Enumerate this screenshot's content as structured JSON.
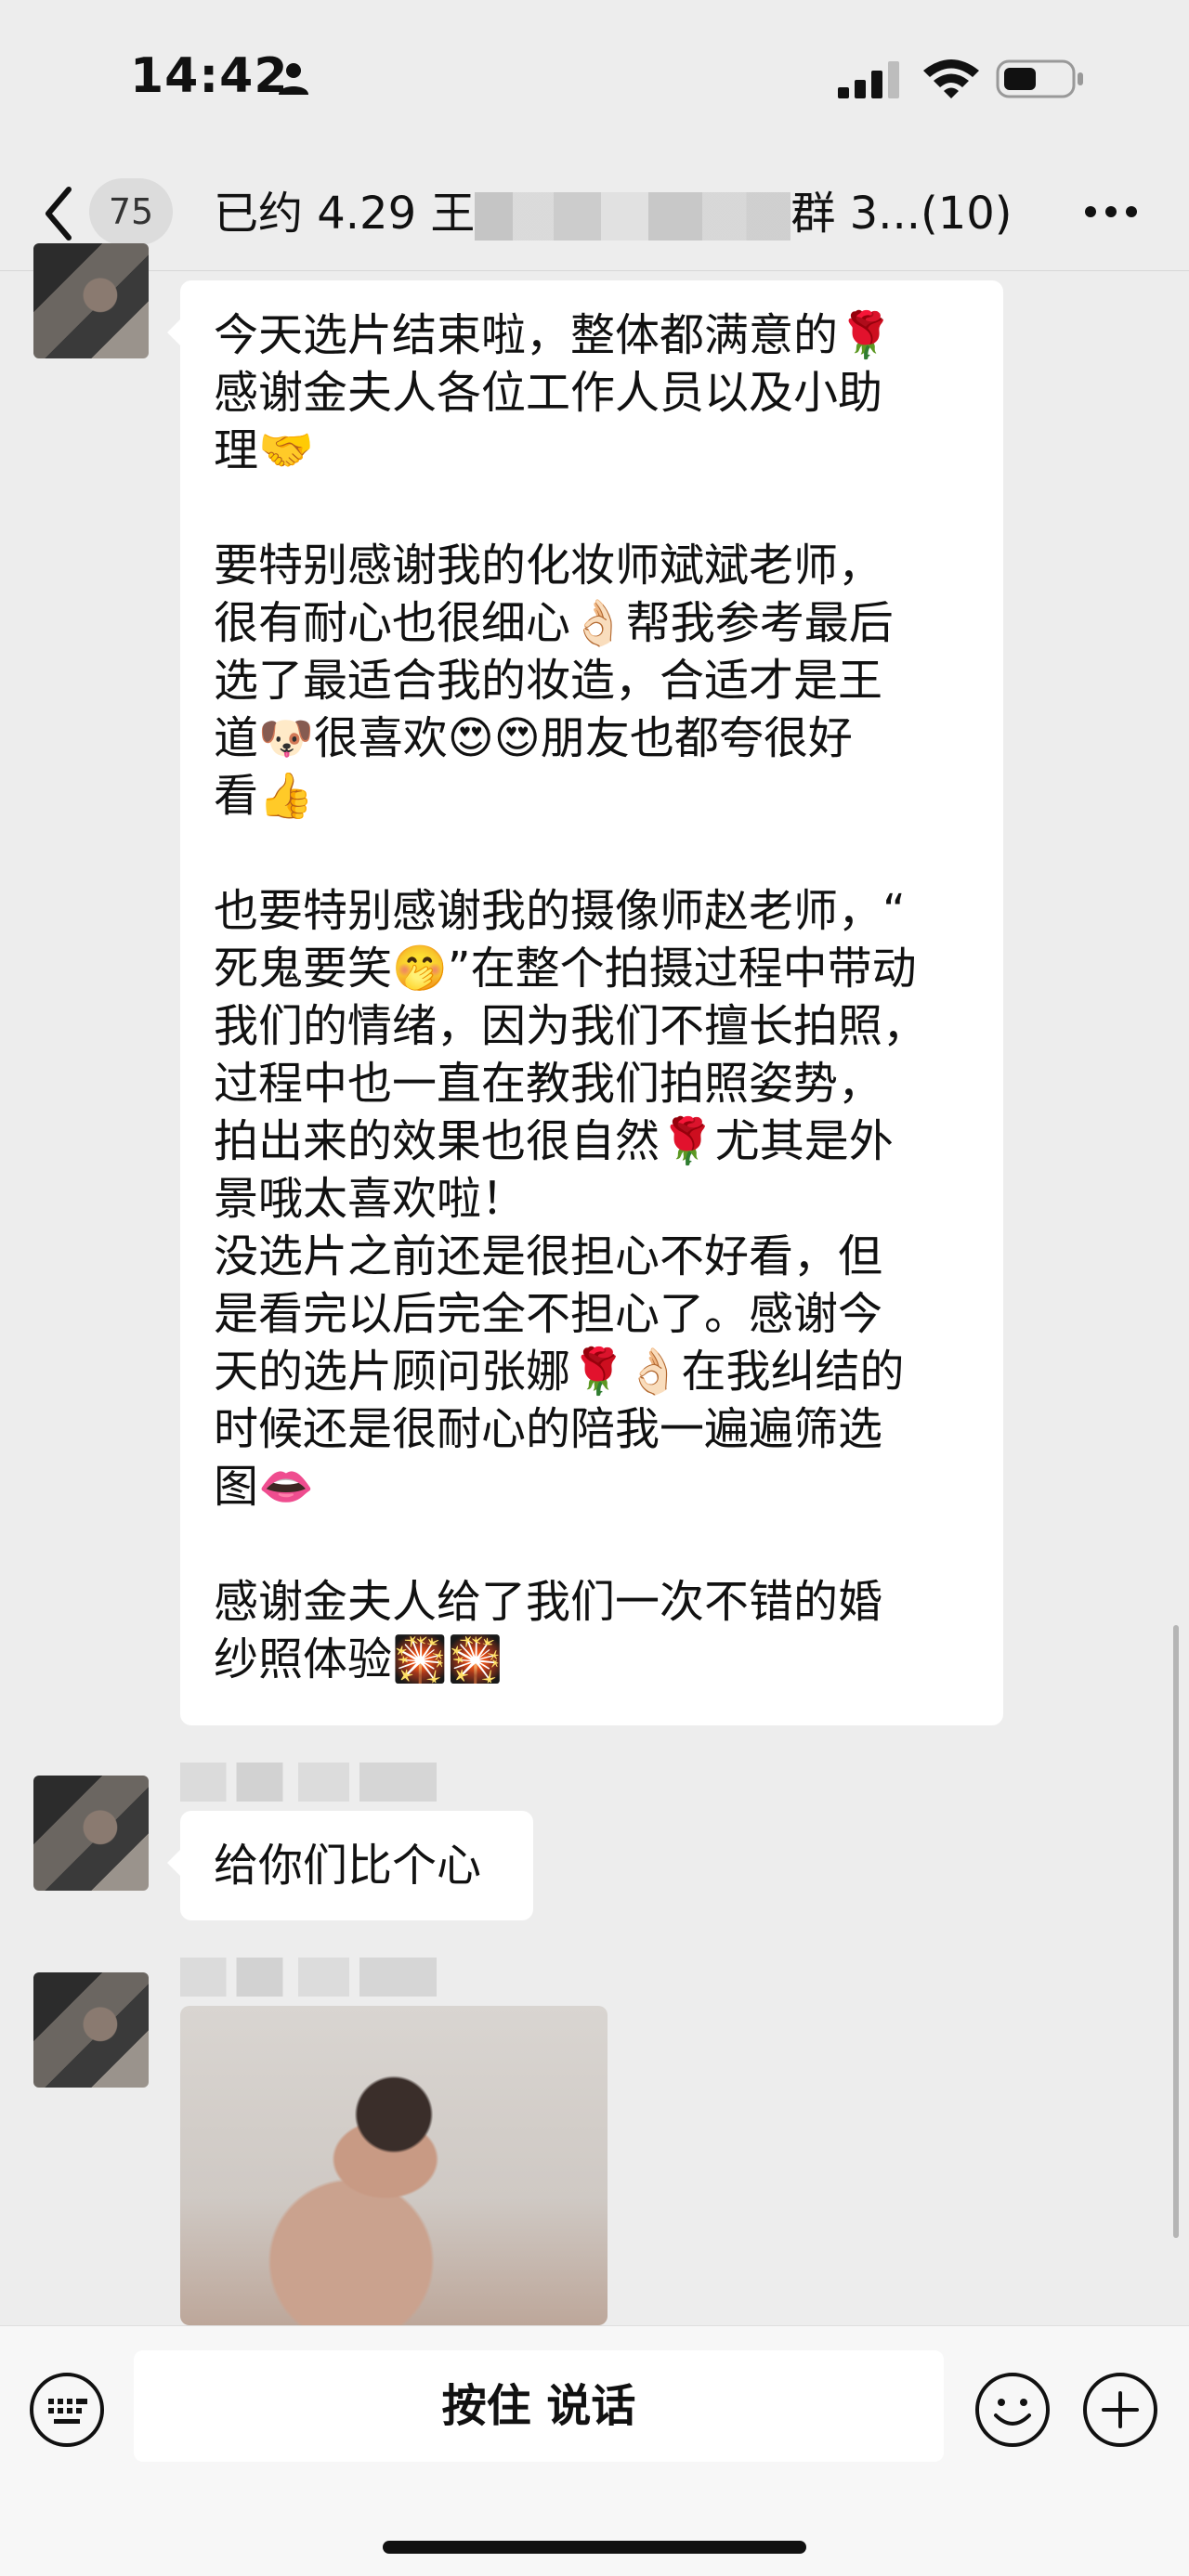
{
  "status_bar": {
    "time": "14:42"
  },
  "nav": {
    "unread_count": "75",
    "title_start": "已约 4.29 王",
    "title_end": "群 3...(10)"
  },
  "messages": {
    "first": {
      "lines": [
        "今天选片结束啦，整体都满意的🌹",
        "感谢金夫人各位工作人员以及小助",
        "理🤝",
        "",
        "要特别感谢我的化妆师斌斌老师，",
        "很有耐心也很细心👌🏻帮我参考最后",
        "选了最适合我的妆造，合适才是王",
        "道🐶很喜欢😍😍朋友也都夸很好",
        "看👍",
        "",
        "也要特别感谢我的摄像师赵老师，“",
        "死鬼要笑🤭”在整个拍摄过程中带动",
        "我们的情绪，因为我们不擅长拍照，",
        "过程中也一直在教我们拍照姿势，",
        "拍出来的效果也很自然🌹尤其是外",
        "景哦太喜欢啦！",
        "没选片之前还是很担心不好看，但",
        "是看完以后完全不担心了。感谢今",
        "天的选片顾问张娜🌹👌🏻在我纠结的",
        "时候还是很耐心的陪我一遍遍筛选",
        "图👄",
        "",
        "感谢金夫人给了我们一次不错的婚",
        "纱照体验🎇🎇"
      ]
    },
    "second": {
      "text": "给你们比个心"
    }
  },
  "input_bar": {
    "hold_to_talk_label": "按住 说话"
  },
  "icons": {
    "back": "back-chevron-icon",
    "more": "more-dots-icon",
    "keyboard": "keyboard-icon",
    "emoji": "emoji-smile-icon",
    "plus": "plus-icon"
  }
}
